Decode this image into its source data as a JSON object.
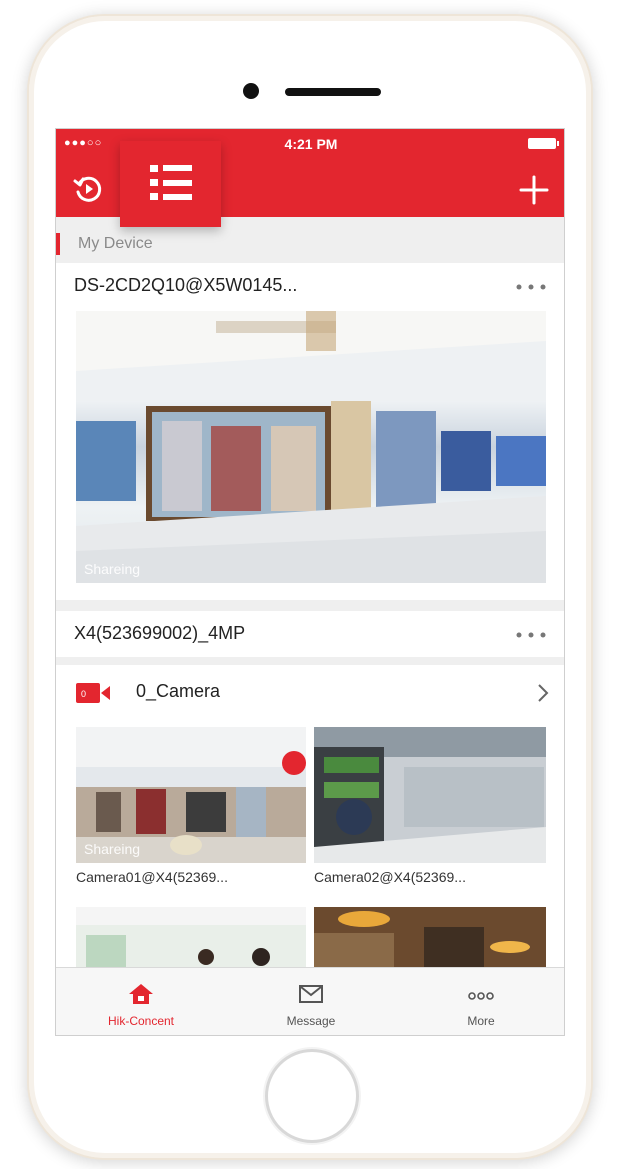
{
  "status_bar": {
    "signal": "●●●○○",
    "time": "4:21 PM"
  },
  "header": {
    "colors": {
      "brand": "#e3262f"
    }
  },
  "section": {
    "title": "My Device"
  },
  "devices": [
    {
      "name": "DS-2CD2Q10@X5W0145...",
      "preview_badge": "Shareing"
    },
    {
      "name": "X4(523699002)_4MP"
    }
  ],
  "camera_group": {
    "label": "0_Camera"
  },
  "cameras": [
    {
      "name": "Camera01@X4(52369...",
      "badge": "Shareing"
    },
    {
      "name": "Camera02@X4(52369..."
    }
  ],
  "tabs": [
    {
      "label": "Hik-Concent",
      "icon": "home-icon",
      "active": true
    },
    {
      "label": "Message",
      "icon": "message-icon",
      "active": false
    },
    {
      "label": "More",
      "icon": "more-icon",
      "active": false
    }
  ]
}
